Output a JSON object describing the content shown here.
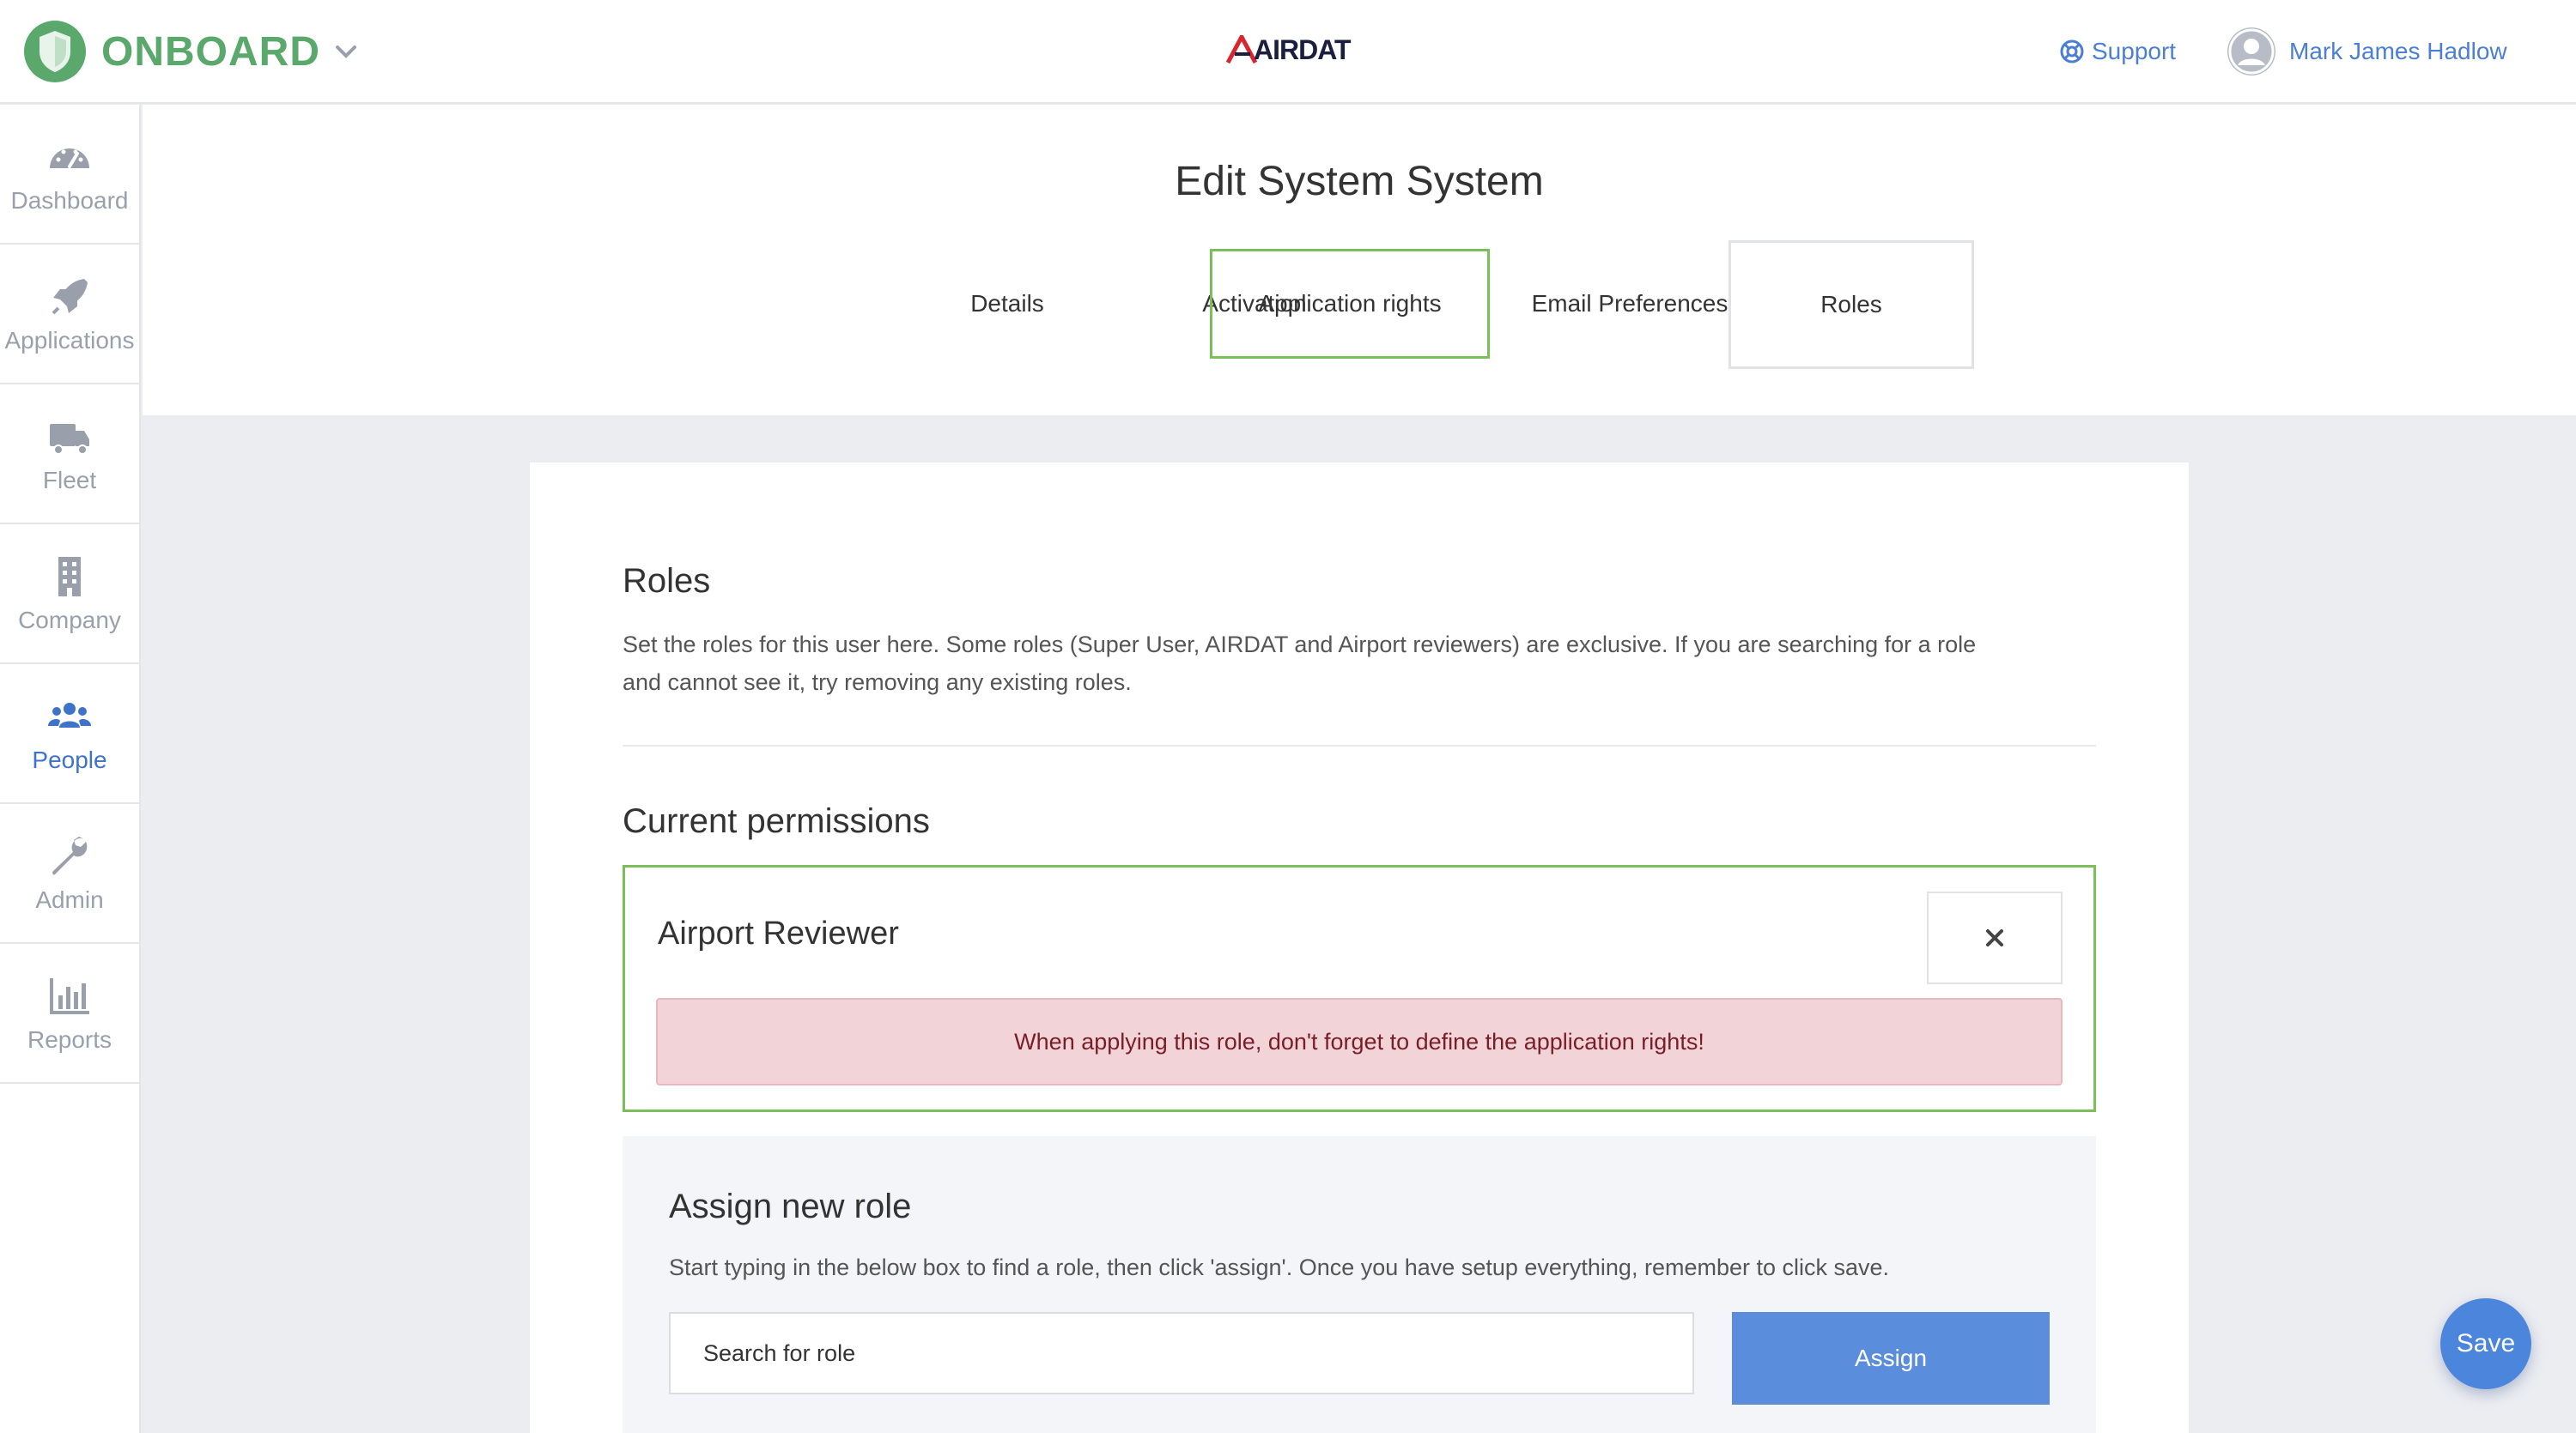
{
  "topbar": {
    "brand": "ONBOARD",
    "center_logo": "AIRDAT",
    "support_label": "Support",
    "user_name": "Mark James Hadlow"
  },
  "sidebar": {
    "items": [
      {
        "label": "Dashboard",
        "icon": "dashboard-icon"
      },
      {
        "label": "Applications",
        "icon": "rocket-icon"
      },
      {
        "label": "Fleet",
        "icon": "truck-icon"
      },
      {
        "label": "Company",
        "icon": "building-icon"
      },
      {
        "label": "People",
        "icon": "people-icon",
        "active": true
      },
      {
        "label": "Admin",
        "icon": "wrench-icon"
      },
      {
        "label": "Reports",
        "icon": "bar-chart-icon"
      }
    ]
  },
  "header": {
    "title": "Edit System System",
    "tabs": [
      {
        "label": "Details"
      },
      {
        "label": "Activation"
      },
      {
        "label": "Application rights"
      },
      {
        "label": "Email Preferences"
      },
      {
        "label": "Roles"
      }
    ]
  },
  "roles": {
    "title": "Roles",
    "description_line1": "Set the roles for this user here. Some roles (Super User, AIRDAT and Airport reviewers) are exclusive. If you are searching for a role",
    "description_line2": "and cannot see it, try removing any existing roles."
  },
  "permissions": {
    "title": "Current permissions",
    "items": [
      {
        "name": "Airport Reviewer",
        "alert": "When applying this role, don't forget to define the application rights!"
      }
    ]
  },
  "assign": {
    "title": "Assign new role",
    "description": "Start typing in the below box to find a role, then click 'assign'. Once you have setup everything, remember to click save.",
    "placeholder": "Search for role",
    "button_label": "Assign"
  },
  "save_label": "Save",
  "colors": {
    "brand_green": "#5aa86b",
    "accent_blue": "#4a7fd4",
    "highlight_green": "#7bbf5a",
    "alert_bg": "#f2d4d8",
    "alert_text": "#7a1d26"
  }
}
